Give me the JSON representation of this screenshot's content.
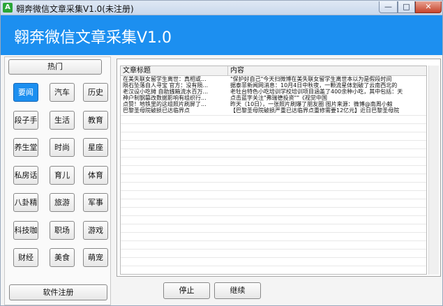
{
  "window": {
    "title": "翱奔微信文章采集V1.0(未注册)",
    "icon_glyph": "A",
    "min_glyph": "—",
    "max_glyph": "□",
    "close_glyph": "✕"
  },
  "header": {
    "title": "翱奔微信文章采集V1.0"
  },
  "sidebar": {
    "hot_label": "热门",
    "register_label": "软件注册",
    "categories": [
      [
        "要闻",
        "汽车",
        "历史"
      ],
      [
        "段子手",
        "生活",
        "教育"
      ],
      [
        "养生堂",
        "时尚",
        "星座"
      ],
      [
        "私房话",
        "育儿",
        "体育"
      ],
      [
        "八卦精",
        "旅游",
        "军事"
      ],
      [
        "科技咖",
        "职场",
        "游戏"
      ],
      [
        "财经",
        "美食",
        "萌宠"
      ]
    ],
    "selected": "要闻"
  },
  "table": {
    "headers": [
      "文章标题",
      "内容"
    ],
    "rows": [
      [
        "在美失联女留学生离世：真相或...",
        "\"保护好自己\"今天扫微博在美失联女留学生离世本以为是假段时间"
      ],
      [
        "陨石坠落自人寻宝 官方：没有陨...",
        "据泰菲新闻网消息：10月4日中秋夜，一颗流星体划破了云南西北的"
      ],
      [
        "老汉设小吃摊 自助銭箱流水百万...",
        "老牡台特色小吃培训学校培训项目涵盖了400余种小吃，其中包括：天"
      ],
      [
        "神户制钢篡改数据影响有组织行...",
        "点击蓝字关注\"弗瑞德投资\"\"《视觉中国"
      ],
      [
        "点赞！地铁里的这组照片刷屏了...",
        "昨天（10日），一张照片刷爆了朋友圈    图片来源：微博@南周小鲸"
      ],
      [
        "巴黎圣母院破损已达临界点",
        "【巴黎圣母院破损严重已达临界点重修需要12亿元】近日巴黎圣母院"
      ]
    ]
  },
  "actions": {
    "stop_label": "停止",
    "continue_label": "继续"
  }
}
